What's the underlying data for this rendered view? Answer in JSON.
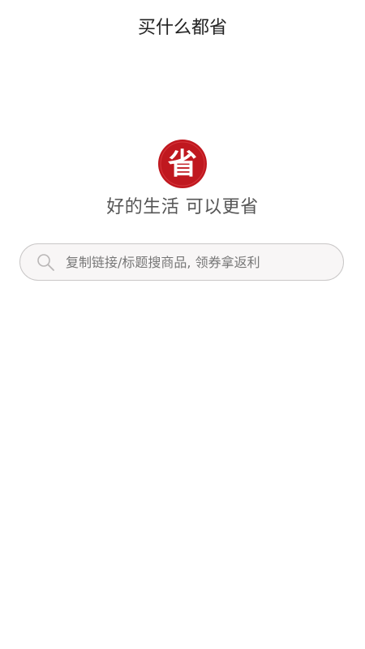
{
  "header": {
    "title": "买什么都省"
  },
  "logo": {
    "char": "省",
    "color": "#c0181f"
  },
  "slogan": {
    "text": "好的生活 可以更省"
  },
  "search": {
    "placeholder": "复制链接/标题搜商品, 领券拿返利",
    "value": "",
    "icon": "search-icon"
  }
}
